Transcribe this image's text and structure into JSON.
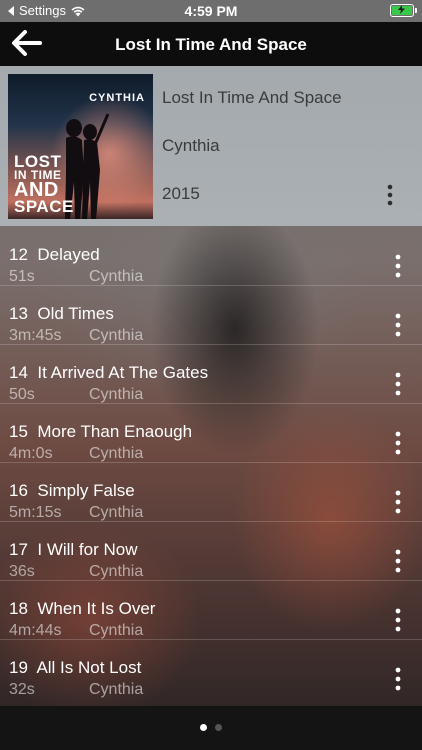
{
  "status": {
    "back_app": "Settings",
    "time": "4:59 PM"
  },
  "nav": {
    "title": "Lost In Time And Space"
  },
  "album": {
    "title": "Lost In Time And Space",
    "artist": "Cynthia",
    "year": "2015",
    "cover_artist": "CYNTHIA",
    "cover_title_lines": [
      "LOST",
      "IN TIME",
      "AND",
      "SPACE"
    ]
  },
  "tracks": [
    {
      "number": "12",
      "title": "Delayed",
      "duration": "51s",
      "artist": "Cynthia"
    },
    {
      "number": "13",
      "title": "Old Times",
      "duration": "3m:45s",
      "artist": "Cynthia"
    },
    {
      "number": "14",
      "title": "It Arrived At The Gates",
      "duration": "50s",
      "artist": "Cynthia"
    },
    {
      "number": "15",
      "title": "More Than Enaough",
      "duration": "4m:0s",
      "artist": "Cynthia"
    },
    {
      "number": "16",
      "title": "Simply False",
      "duration": "5m:15s",
      "artist": "Cynthia"
    },
    {
      "number": "17",
      "title": "I Will for Now",
      "duration": "36s",
      "artist": "Cynthia"
    },
    {
      "number": "18",
      "title": "When It Is Over",
      "duration": "4m:44s",
      "artist": "Cynthia"
    },
    {
      "number": "19",
      "title": "All Is Not Lost",
      "duration": "32s",
      "artist": "Cynthia"
    }
  ],
  "pager": {
    "page_count": 2,
    "active_index": 0
  },
  "colors": {
    "battery_fill": "#38c94a",
    "nav_background": "#0d0d0d",
    "header_background": "#a9afb3",
    "dot_active": "#ffffff",
    "dot_inactive": "#555555"
  },
  "icons": {
    "back": "arrow-left-icon",
    "more": "vertical-ellipsis-icon",
    "wifi": "wifi-icon",
    "battery": "battery-charging-icon"
  }
}
